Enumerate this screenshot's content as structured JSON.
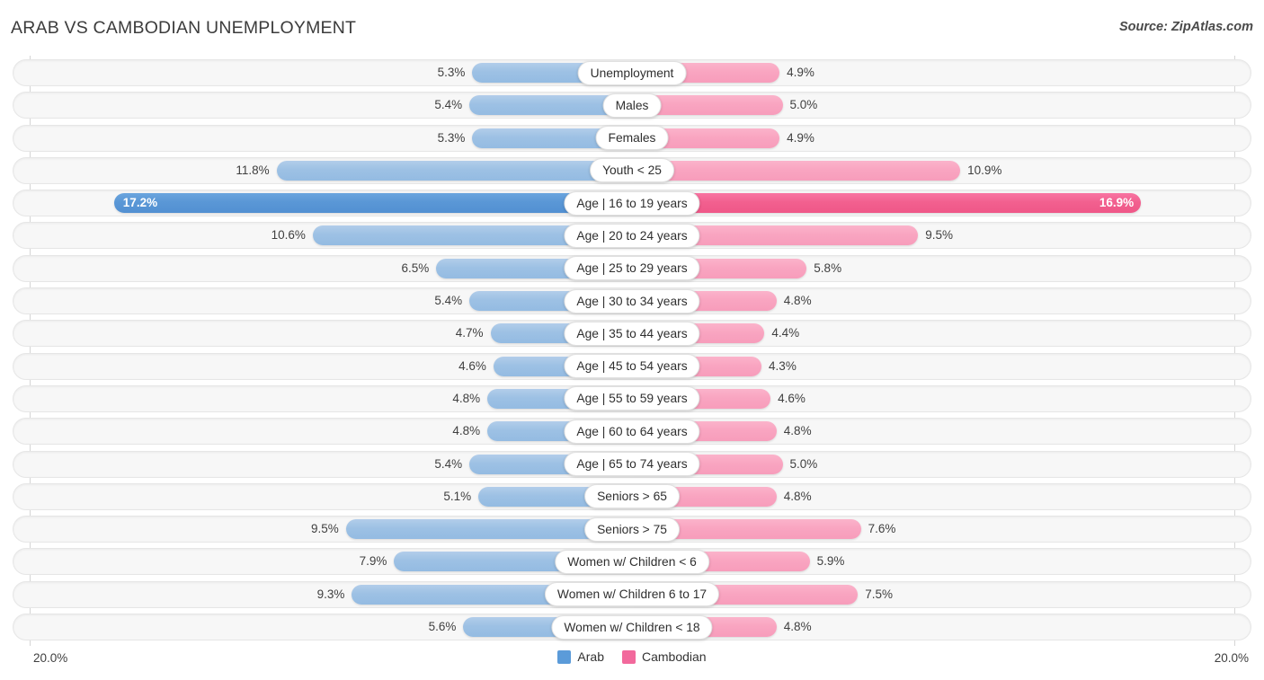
{
  "header": {
    "title": "ARAB VS CAMBODIAN UNEMPLOYMENT",
    "source": "Source: ZipAtlas.com"
  },
  "axis": {
    "min_label": "20.0%",
    "max_label": "20.0%",
    "max_value": 20.0
  },
  "legend": [
    {
      "label": "Arab",
      "color": "#5b9bd9"
    },
    {
      "label": "Cambodian",
      "color": "#f2699c"
    }
  ],
  "colors": {
    "arab_light": "#9dc1e4",
    "arab_dark": "#5a97d6",
    "cambodian_light": "#f9a5c1",
    "cambodian_dark": "#f2608f",
    "track": "#f7f7f7",
    "pill": "#ffffff"
  },
  "chart_data": {
    "type": "bar",
    "title": "ARAB VS CAMBODIAN UNEMPLOYMENT",
    "subtitle": "Source: ZipAtlas.com",
    "orientation": "horizontal-diverging",
    "xlabel": "",
    "ylabel": "",
    "xlim": [
      20.0,
      20.0
    ],
    "grid": false,
    "legend_position": "bottom-center",
    "categories": [
      "Unemployment",
      "Males",
      "Females",
      "Youth < 25",
      "Age | 16 to 19 years",
      "Age | 20 to 24 years",
      "Age | 25 to 29 years",
      "Age | 30 to 34 years",
      "Age | 35 to 44 years",
      "Age | 45 to 54 years",
      "Age | 55 to 59 years",
      "Age | 60 to 64 years",
      "Age | 65 to 74 years",
      "Seniors > 65",
      "Seniors > 75",
      "Women w/ Children < 6",
      "Women w/ Children 6 to 17",
      "Women w/ Children < 18"
    ],
    "series": [
      {
        "name": "Arab",
        "side": "left",
        "color": "#9dc1e4",
        "values": [
          5.3,
          5.4,
          5.3,
          11.8,
          17.2,
          10.6,
          6.5,
          5.4,
          4.7,
          4.6,
          4.8,
          4.8,
          5.4,
          5.1,
          9.5,
          7.9,
          9.3,
          5.6
        ],
        "labels": [
          "5.3%",
          "5.4%",
          "5.3%",
          "11.8%",
          "17.2%",
          "10.6%",
          "6.5%",
          "5.4%",
          "4.7%",
          "4.6%",
          "4.8%",
          "4.8%",
          "5.4%",
          "5.1%",
          "9.5%",
          "7.9%",
          "9.3%",
          "5.6%"
        ]
      },
      {
        "name": "Cambodian",
        "side": "right",
        "color": "#f9a5c1",
        "values": [
          4.9,
          5.0,
          4.9,
          10.9,
          16.9,
          9.5,
          5.8,
          4.8,
          4.4,
          4.3,
          4.6,
          4.8,
          5.0,
          4.8,
          7.6,
          5.9,
          7.5,
          4.8
        ],
        "labels": [
          "4.9%",
          "5.0%",
          "4.9%",
          "10.9%",
          "16.9%",
          "9.5%",
          "5.8%",
          "4.8%",
          "4.4%",
          "4.3%",
          "4.6%",
          "4.8%",
          "5.0%",
          "4.8%",
          "7.6%",
          "5.9%",
          "7.5%",
          "4.8%"
        ]
      }
    ],
    "highlighted_row_index": 4
  }
}
